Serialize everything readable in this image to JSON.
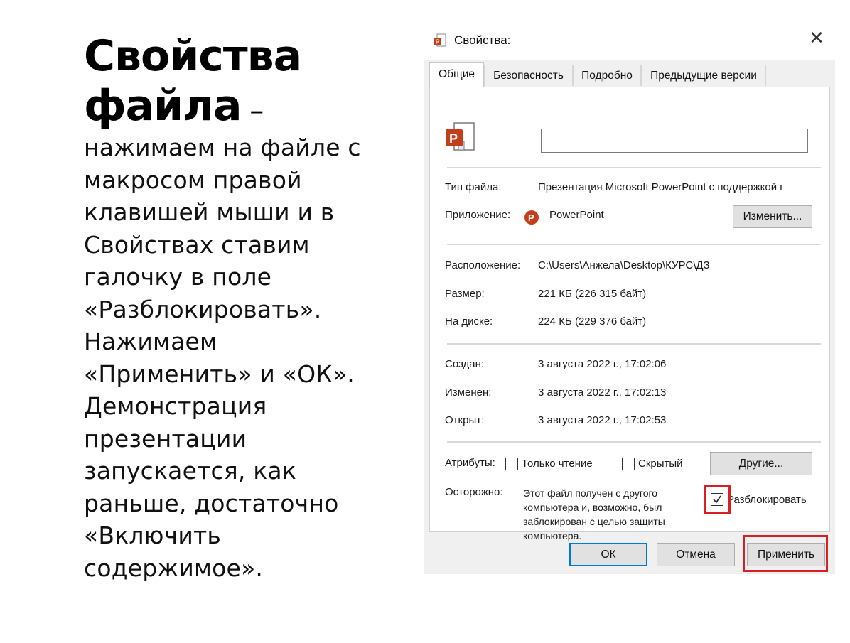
{
  "slide": {
    "title_line1": "Свойства",
    "title_line2": "файла",
    "title_dash": " –",
    "body": "нажимаем на файле с\nмакросом правой\nклавишей мыши и в\nСвойствах ставим\nгалочку в поле\n«Разблокировать».\nНажимаем\n«Применить» и «ОК».\nДемонстрация\nпрезентации\nзапускается, как\nраньше, достаточно\n«Включить\nсодержимое»."
  },
  "dialog": {
    "title": "Свойства:",
    "close_glyph": "✕",
    "tabs": [
      "Общие",
      "Безопасность",
      "Подробно",
      "Предыдущие версии"
    ],
    "filename_value": "",
    "rows": {
      "file_type_label": "Тип файла:",
      "file_type_value": "Презентация Microsoft PowerPoint с поддержкой г",
      "app_label": "Приложение:",
      "app_value": "PowerPoint",
      "change_button": "Изменить...",
      "location_label": "Расположение:",
      "location_value": "C:\\Users\\Анжела\\Desktop\\КУРС\\ДЗ",
      "size_label": "Размер:",
      "size_value": "221 КБ (226 315 байт)",
      "disk_label": "На диске:",
      "disk_value": "224 КБ (229 376 байт)",
      "created_label": "Создан:",
      "created_value": "3 августа 2022 г., 17:02:06",
      "modified_label": "Изменен:",
      "modified_value": "3 августа 2022 г., 17:02:13",
      "opened_label": "Открыт:",
      "opened_value": "3 августа 2022 г., 17:02:53",
      "attributes_label": "Атрибуты:",
      "readonly_label": "Только чтение",
      "hidden_label": "Скрытый",
      "other_button": "Другие...",
      "warning_label": "Осторожно:",
      "warning_text": "Этот файл получен с другого\nкомпьютера и, возможно, был\nзаблокирован с целью защиты\nкомпьютера.",
      "unblock_label": "Разблокировать",
      "unblock_checked": true
    },
    "buttons": {
      "ok": "ОК",
      "cancel": "Отмена",
      "apply": "Применить"
    },
    "colors": {
      "highlight": "#d91f26",
      "ok_border": "#0078d7",
      "pp_orange": "#c43e1c"
    }
  }
}
